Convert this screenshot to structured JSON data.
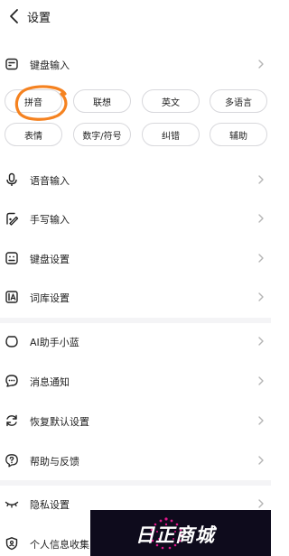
{
  "header": {
    "title": "设置"
  },
  "keyboard_input": {
    "label": "键盘输入",
    "chips": [
      "拼音",
      "联想",
      "英文",
      "多语言",
      "表情",
      "数字/符号",
      "纠错",
      "辅助"
    ]
  },
  "menu": {
    "voice_input": "语音输入",
    "handwriting_input": "手写输入",
    "keyboard_settings": "键盘设置",
    "lexicon_settings": "词库设置",
    "ai_assistant": "AI助手小蓝",
    "notifications": "消息通知",
    "restore_defaults": "恢复默认设置",
    "help_feedback": "帮助与反馈",
    "privacy_settings": "隐私设置",
    "personal_info": "个人信息收集"
  },
  "annotation": {
    "color": "#f58220"
  },
  "watermark": {
    "text": "日正商城"
  }
}
